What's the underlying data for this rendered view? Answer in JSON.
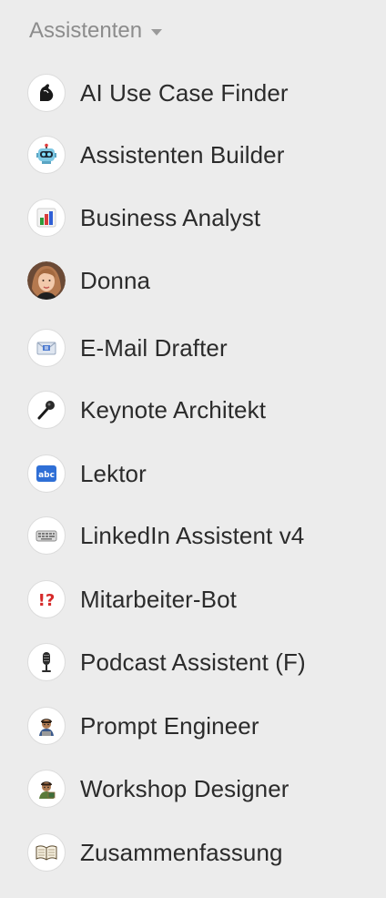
{
  "section": {
    "title": "Assistenten",
    "caret_icon": "caret-down-icon"
  },
  "assistants": [
    {
      "label": "AI Use Case Finder",
      "icon": "flexed-biceps-icon"
    },
    {
      "label": "Assistenten Builder",
      "icon": "robot-icon"
    },
    {
      "label": "Business Analyst",
      "icon": "bar-chart-icon"
    },
    {
      "label": "Donna",
      "icon": "donna-avatar"
    },
    {
      "label": "E-Mail Drafter",
      "icon": "envelope-icon"
    },
    {
      "label": "Keynote Architekt",
      "icon": "microphone-icon"
    },
    {
      "label": "Lektor",
      "icon": "abc-icon"
    },
    {
      "label": "LinkedIn Assistent v4",
      "icon": "keyboard-icon"
    },
    {
      "label": "Mitarbeiter-Bot",
      "icon": "exclamation-question-icon"
    },
    {
      "label": "Podcast Assistent (F)",
      "icon": "studio-microphone-icon"
    },
    {
      "label": "Prompt Engineer",
      "icon": "technologist-icon"
    },
    {
      "label": "Workshop Designer",
      "icon": "teacher-icon"
    },
    {
      "label": "Zusammenfassung",
      "icon": "open-book-icon"
    }
  ]
}
